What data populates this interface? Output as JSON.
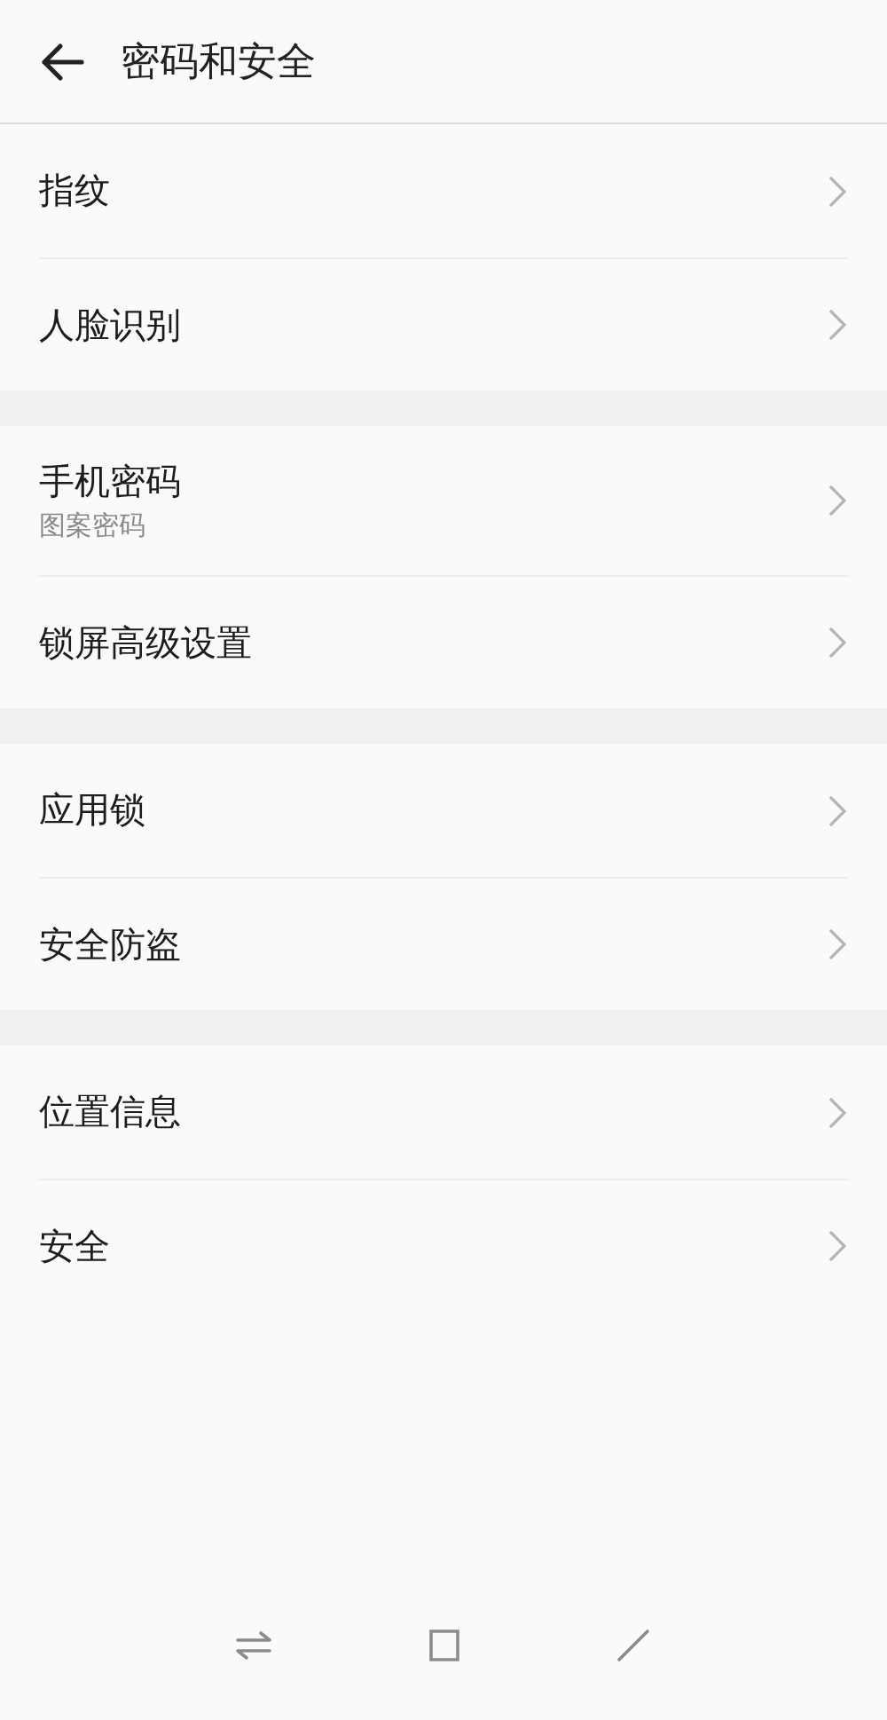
{
  "header": {
    "title": "密码和安全"
  },
  "groups": [
    {
      "items": [
        {
          "label": "指纹"
        },
        {
          "label": "人脸识别"
        }
      ]
    },
    {
      "items": [
        {
          "label": "手机密码",
          "subtitle": "图案密码"
        },
        {
          "label": "锁屏高级设置"
        }
      ]
    },
    {
      "items": [
        {
          "label": "应用锁"
        },
        {
          "label": "安全防盗"
        }
      ]
    },
    {
      "items": [
        {
          "label": "位置信息"
        },
        {
          "label": "安全"
        }
      ]
    }
  ]
}
